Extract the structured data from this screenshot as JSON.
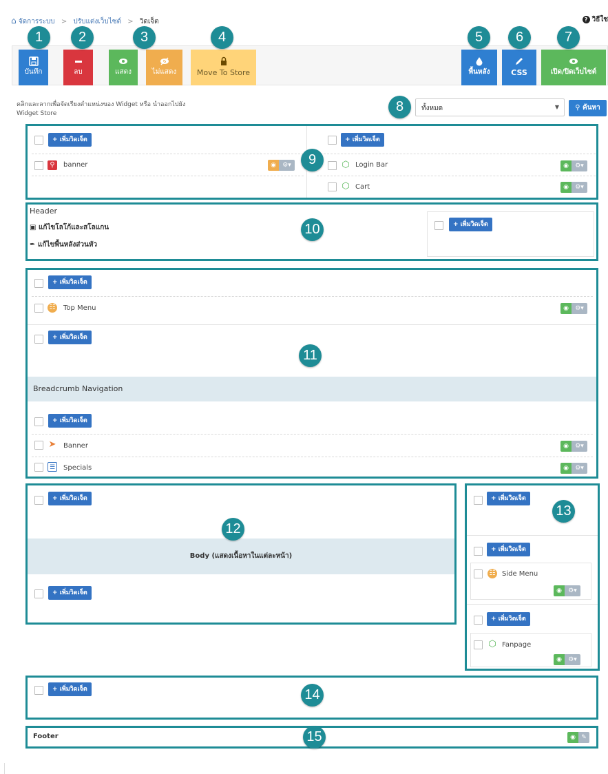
{
  "breadcrumb": {
    "home": "จัดการระบบ",
    "level2": "ปรับแต่งเว็บไซต์",
    "current": "วิดเจ็ต"
  },
  "help_label": "วิธีใช",
  "toolbar": {
    "save": "บันทึก",
    "delete": "ลบ",
    "show": "แสดง",
    "hide": "ไม่แสดง",
    "move_to_store": "Move To Store",
    "background": "พื้นหลัง",
    "css": "CSS",
    "toggle_site": "เปิด/ปิดเว็บไซต์"
  },
  "description": "คลิกและลากเพื่อจัดเรียงตำแหน่งของ Widget หรือ นำออกไปยัง Widget Store",
  "filter": {
    "selected": "ทั้งหมด",
    "search_label": "ค้นหา"
  },
  "add_widget_label": "เพิ่มวิดเจ็ต",
  "widgets": {
    "banner_top": "banner",
    "login_bar": "Login Bar",
    "cart": "Cart",
    "top_menu": "Top Menu",
    "banner": "Banner",
    "specials": "Specials",
    "side_menu": "Side Menu",
    "fanpage": "Fanpage"
  },
  "header": {
    "title": "Header",
    "edit_logo": "แก้ไขโลโก้และสโลแกน",
    "edit_bg": "แก้ไขพื้นหลังส่วนหัว"
  },
  "breadcrumb_nav_label": "Breadcrumb Navigation",
  "body_label": "Body (แสดงเนื้อหาในแต่ละหน้า)",
  "footer_label": "Footer",
  "callouts": [
    "1",
    "2",
    "3",
    "4",
    "5",
    "6",
    "7",
    "8",
    "9",
    "10",
    "11",
    "12",
    "13",
    "14",
    "15"
  ],
  "colors": {
    "callout": "#1e8c96",
    "primary": "#3473c3",
    "danger": "#d9363e",
    "success": "#5cb85c",
    "warning": "#f0ad4e",
    "store": "#ffd479"
  },
  "icons": {
    "home": "home-icon",
    "save": "floppy-icon",
    "delete": "minus-icon",
    "show": "eye-icon",
    "hide": "eye-slash-icon",
    "lock": "lock-icon",
    "bg": "drop-icon",
    "css": "pencil-icon",
    "toggle": "eye-icon"
  }
}
